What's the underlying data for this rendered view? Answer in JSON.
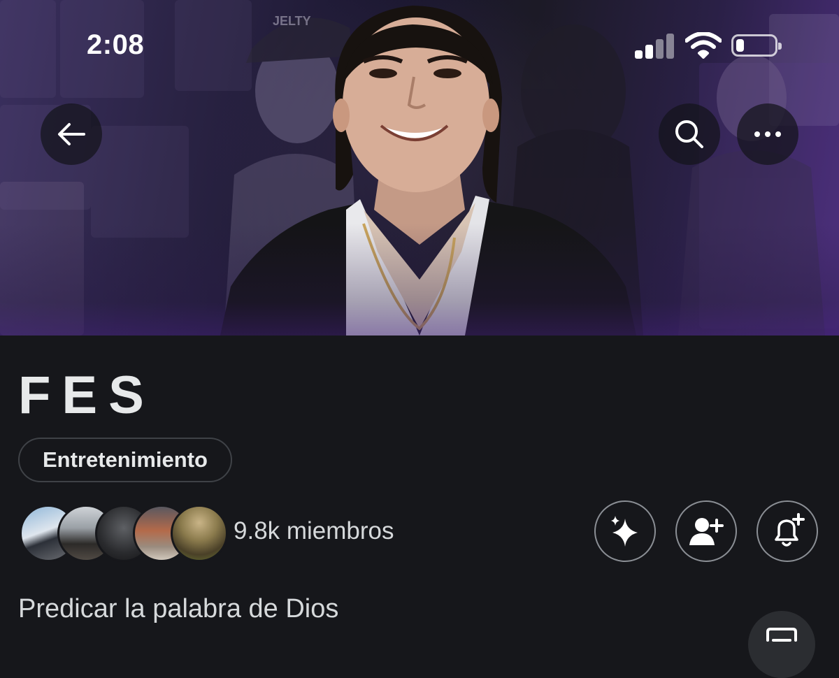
{
  "status_bar": {
    "time": "2:08",
    "signal_icon": "cellular-signal-icon",
    "wifi_icon": "wifi-icon",
    "battery_icon": "battery-icon",
    "battery_level": 0.2
  },
  "header": {
    "back_icon": "arrow-left-icon",
    "search_icon": "search-icon",
    "more_icon": "more-horizontal-icon"
  },
  "banner": {
    "cap_text": "JELTY"
  },
  "community": {
    "name": "FES",
    "category": "Entretenimiento",
    "members_label": "9.8k miembros",
    "description": "Predicar la palabra de Dios",
    "member_avatar_count": 5
  },
  "actions": {
    "sparkle_icon": "sparkle-icon",
    "add_member_icon": "add-person-icon",
    "notifications_icon": "bell-plus-icon",
    "floating_icon": "compose-icon"
  },
  "colors": {
    "background": "#16171b",
    "text": "#e7e9ea",
    "banner_accent": "#4a2d7a",
    "outline": "#8b8f95"
  }
}
